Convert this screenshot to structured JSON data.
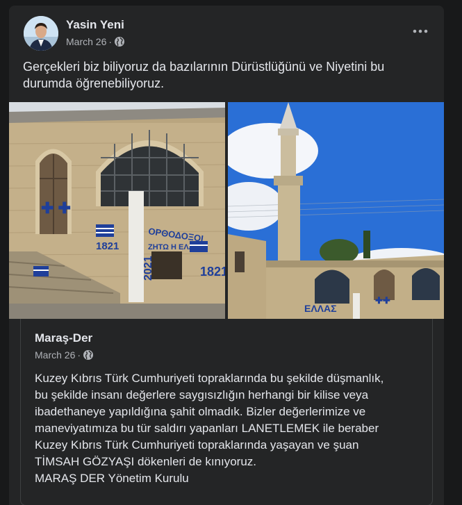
{
  "post": {
    "author": "Yasin Yeni",
    "date": "March 26",
    "separator": "·",
    "privacy_icon": "globe-icon",
    "more_icon": "more-options-icon",
    "text": "Gerçekleri biz biliyoruz da bazılarının  Dürüstlüğünü ve Niyetini bu durumda öğrenebiliyoruz."
  },
  "photos": {
    "left_graffiti": [
      "ΟΡΘΟΔΟΞΟΙ",
      "1821",
      "ΖΗΤΩ Η ΕΛΛΑΣ",
      "2021",
      "1821"
    ],
    "right_graffiti": [
      "ΕΛΛΑΣ"
    ]
  },
  "shared": {
    "name": "Maraş-Der",
    "date": "March 26",
    "separator": "·",
    "privacy_icon": "globe-icon",
    "lines": [
      "Kuzey Kıbrıs Türk Cumhuriyeti topraklarında bu şekilde düşmanlık,",
      "bu şekilde insanı değerlere saygısızlığın herhangi bir kilise veya",
      "ibadethaneye yapıldığına şahit olmadık. Bizler değerlerimize ve",
      "maneviyatımıza bu tür saldırı yapanları LANETLEMEK ile beraber",
      "Kuzey Kıbrıs Türk Cumhuriyeti topraklarında yaşayan ve şuan",
      "TİMSAH GÖZYAŞI dökenleri de kınıyoruz.",
      "MARAŞ DER Yönetim Kurulu"
    ]
  },
  "colors": {
    "background": "#18191a",
    "card": "#242526",
    "primary_text": "#e4e6eb",
    "secondary_text": "#b0b3b8",
    "graffiti_blue": "#1f3f9a"
  }
}
